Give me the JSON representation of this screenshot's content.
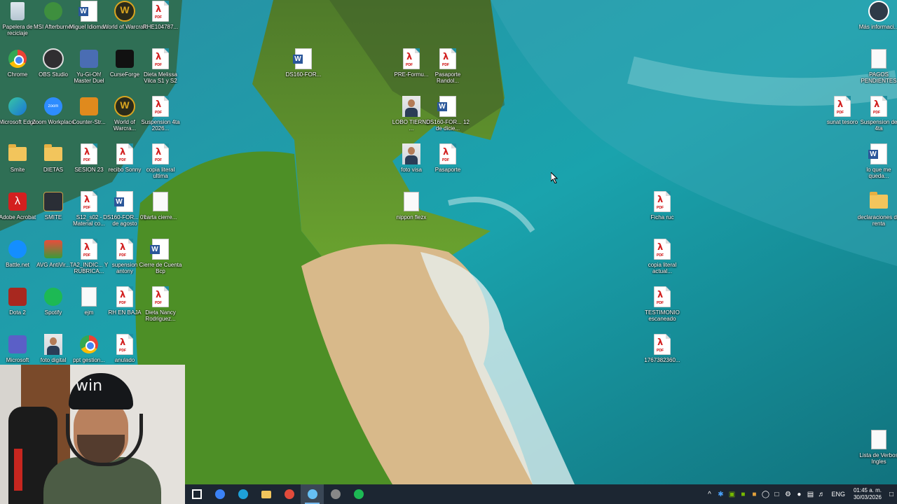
{
  "desktop": {
    "icons": [
      {
        "label": "Papelera de reciclaje",
        "icon": "recycle-bin-icon"
      },
      {
        "label": "MSI Afterburner",
        "icon": "msi-icon"
      },
      {
        "label": "Miguel Idioma...",
        "icon": "word-icon"
      },
      {
        "label": "World of Warcraft",
        "icon": "wow-icon"
      },
      {
        "label": "RHE104787...",
        "icon": "pdf-icon"
      },
      {
        "label": "Chrome",
        "icon": "chrome-icon"
      },
      {
        "label": "OBS Studio",
        "icon": "obs-icon"
      },
      {
        "label": "Yu-Gi-Oh! Master Duel",
        "icon": "yugioh-icon"
      },
      {
        "label": "CurseForge",
        "icon": "curseforge-icon"
      },
      {
        "label": "Dieta Melissa Vilca S1 y S2",
        "icon": "pdf-icon"
      },
      {
        "label": "Microsoft Edge",
        "icon": "edge-icon"
      },
      {
        "label": "Zoom Workplace",
        "icon": "zoom-icon"
      },
      {
        "label": "Counter-Str...",
        "icon": "counter-strike-icon"
      },
      {
        "label": "World of Warcra...",
        "icon": "wow-icon"
      },
      {
        "label": "Suspension 4ta 2026...",
        "icon": "pdf-icon"
      },
      {
        "label": "Smite",
        "icon": "folder-icon"
      },
      {
        "label": "DIETAS",
        "icon": "folder-icon"
      },
      {
        "label": "SESION 23",
        "icon": "pdf-icon"
      },
      {
        "label": "recibo Sonny",
        "icon": "pdf-icon"
      },
      {
        "label": "copia literal ultima",
        "icon": "pdf-icon"
      },
      {
        "label": "Adobe Acrobat",
        "icon": "acrobat-icon"
      },
      {
        "label": "SMITE",
        "icon": "smite-icon"
      },
      {
        "label": "S12_s02 - Material co...",
        "icon": "pdf-icon"
      },
      {
        "label": "DS160-FOR... 05 de agosto",
        "icon": "word-icon"
      },
      {
        "label": "carta cierre...",
        "icon": "document-icon"
      },
      {
        "label": "Battle.net",
        "icon": "battlenet-icon"
      },
      {
        "label": "AVG AntiVir...",
        "icon": "avg-icon"
      },
      {
        "label": "TA2_INDIC... Y RUBRICA...",
        "icon": "pdf-icon"
      },
      {
        "label": "supension antony",
        "icon": "pdf-icon"
      },
      {
        "label": "Cierre de Cuenta Bcp",
        "icon": "word-icon"
      },
      {
        "label": "Dota 2",
        "icon": "dota-icon"
      },
      {
        "label": "Spotify",
        "icon": "spotify-icon"
      },
      {
        "label": "ejm",
        "icon": "document-icon"
      },
      {
        "label": "RH EN BAJA",
        "icon": "pdf-icon"
      },
      {
        "label": "Dieta Nancy Rodriguez...",
        "icon": "pdf-icon"
      },
      {
        "label": "Microsoft",
        "icon": "teams-icon"
      },
      {
        "label": "foto digital",
        "icon": "photo-icon"
      },
      {
        "label": "ppt gestion...",
        "icon": "chrome-icon"
      },
      {
        "label": "anulado",
        "icon": "pdf-icon"
      },
      {
        "label": "DS160-FOR...",
        "icon": "word-icon"
      },
      {
        "label": "PRE-Formu...",
        "icon": "pdf-icon"
      },
      {
        "label": "Pasaporte Randol...",
        "icon": "pdf-icon"
      },
      {
        "label": "LOBO TIERNO ...",
        "icon": "image-icon"
      },
      {
        "label": "DS160-FOR... 12 de dicie...",
        "icon": "word-icon"
      },
      {
        "label": "foto visa",
        "icon": "photo-icon"
      },
      {
        "label": "Pasaporte",
        "icon": "pdf-icon"
      },
      {
        "label": "nippon flezx",
        "icon": "document-icon"
      },
      {
        "label": "Ficha ruc",
        "icon": "pdf-icon"
      },
      {
        "label": "copia literal actual...",
        "icon": "pdf-icon"
      },
      {
        "label": "TESTIMONIO escaneado",
        "icon": "pdf-icon"
      },
      {
        "label": "1767382360...",
        "icon": "pdf-icon"
      },
      {
        "label": "Más informaci...",
        "icon": "info-icon"
      },
      {
        "label": "PAGOS PENDIENTES",
        "icon": "document-icon"
      },
      {
        "label": "sunat tesoro",
        "icon": "pdf-icon"
      },
      {
        "label": "Suspension de 4ta",
        "icon": "pdf-icon"
      },
      {
        "label": "lo que me queda...",
        "icon": "word-icon"
      },
      {
        "label": "declaraciones de renta",
        "icon": "folder-icon"
      },
      {
        "label": "Lista de Verbos Ingles",
        "icon": "document-icon"
      }
    ]
  },
  "taskbar": {
    "apps": [
      {
        "name": "task-view",
        "icon": "task-view-icon",
        "color": "#ffffff"
      },
      {
        "name": "chromium",
        "icon": "chromium-icon",
        "color": "#3b82f6"
      },
      {
        "name": "edge",
        "icon": "edge-icon",
        "color": "#1ea0d8"
      },
      {
        "name": "file-explorer",
        "icon": "folder-icon",
        "color": "#f2c55c"
      },
      {
        "name": "chrome",
        "icon": "chrome-icon",
        "color": "#e24b3b"
      },
      {
        "name": "steam",
        "icon": "steam-icon",
        "color": "#66c0f4"
      },
      {
        "name": "obs",
        "icon": "obs-icon",
        "color": "#888888"
      },
      {
        "name": "spotify",
        "icon": "spotify-icon",
        "color": "#1db954"
      }
    ],
    "language": "ENG",
    "time": "01:45 a. m.",
    "date": "30/03/2026"
  },
  "webcam": {
    "cap_text": "win"
  }
}
